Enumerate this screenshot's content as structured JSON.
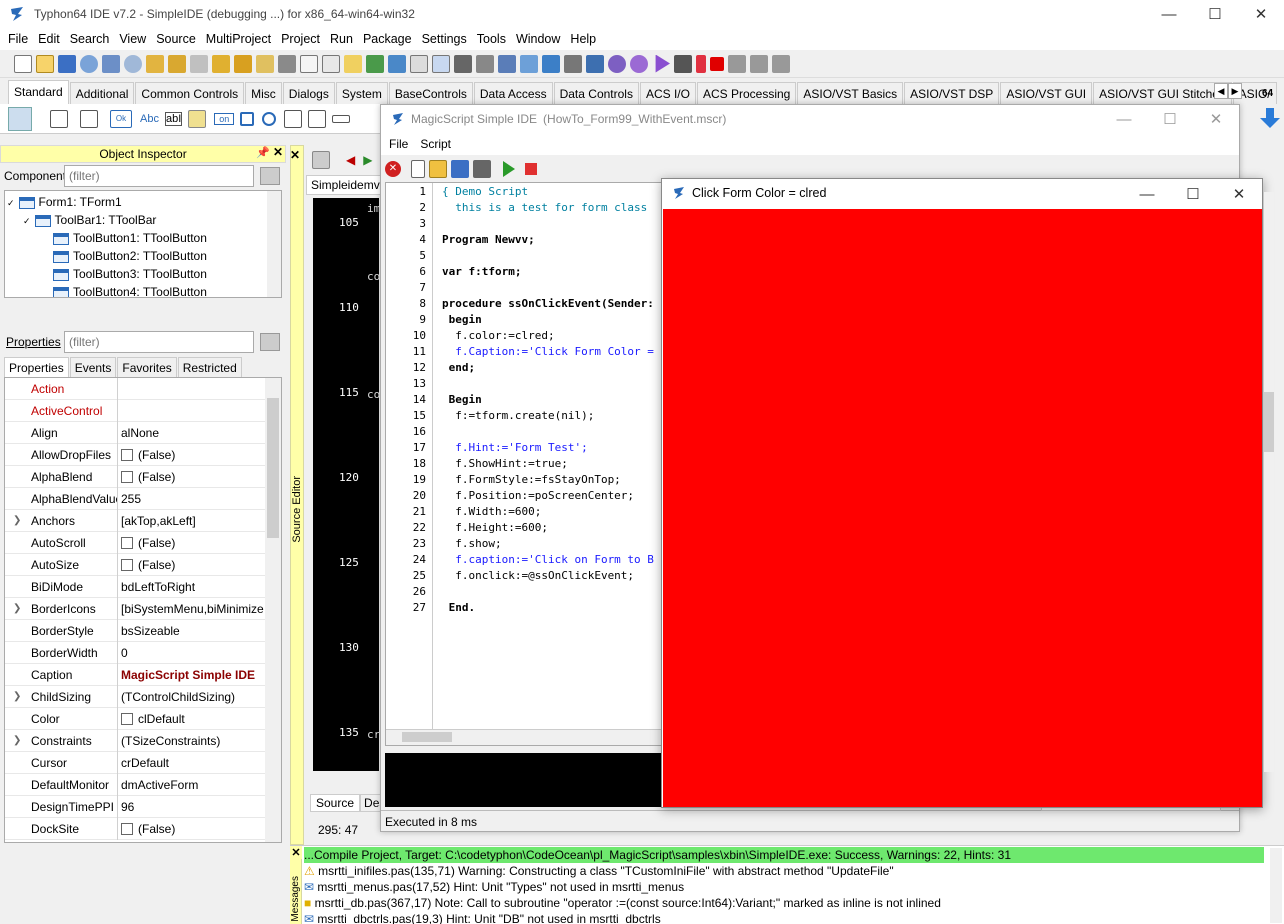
{
  "window": {
    "title": "Typhon64 IDE v7.2 - SimpleIDE (debugging ...) for x86_64-win64-win32"
  },
  "menu": [
    "File",
    "Edit",
    "Search",
    "View",
    "Source",
    "MultiProject",
    "Project",
    "Run",
    "Package",
    "Settings",
    "Tools",
    "Window",
    "Help"
  ],
  "palette_tabs": [
    "Standard",
    "Additional",
    "Common Controls",
    "Misc",
    "Dialogs",
    "System",
    "BaseControls",
    "Data Access",
    "Data Controls",
    "ACS I/O",
    "ACS Processing",
    "ASIO/VST Basics",
    "ASIO/VST DSP",
    "ASIO/VST GUI",
    "ASIO/VST GUI Stitched",
    "ASIO/"
  ],
  "palette_badge": "64",
  "object_inspector": {
    "title": "Object Inspector",
    "components_label": "Components",
    "filter_placeholder": "(filter)",
    "tree": [
      {
        "label": "Form1: TForm1"
      },
      {
        "label": "ToolBar1: TToolBar"
      },
      {
        "label": "ToolButton1: TToolButton"
      },
      {
        "label": "ToolButton2: TToolButton"
      },
      {
        "label": "ToolButton3: TToolButton"
      },
      {
        "label": "ToolButton4: TToolButton"
      }
    ],
    "properties_label": "Properties",
    "tabs": [
      "Properties",
      "Events",
      "Favorites",
      "Restricted"
    ],
    "properties": [
      {
        "name": "Action",
        "value": "",
        "expand": false,
        "check": false,
        "red": true
      },
      {
        "name": "ActiveControl",
        "value": "",
        "expand": false,
        "check": false,
        "red": true
      },
      {
        "name": "Align",
        "value": "alNone",
        "expand": false,
        "check": false
      },
      {
        "name": "AllowDropFiles",
        "value": "(False)",
        "expand": false,
        "check": true
      },
      {
        "name": "AlphaBlend",
        "value": "(False)",
        "expand": false,
        "check": true
      },
      {
        "name": "AlphaBlendValue",
        "value": "255",
        "expand": false,
        "check": false
      },
      {
        "name": "Anchors",
        "value": "[akTop,akLeft]",
        "expand": true,
        "check": false
      },
      {
        "name": "AutoScroll",
        "value": "(False)",
        "expand": false,
        "check": true
      },
      {
        "name": "AutoSize",
        "value": "(False)",
        "expand": false,
        "check": true
      },
      {
        "name": "BiDiMode",
        "value": "bdLeftToRight",
        "expand": false,
        "check": false
      },
      {
        "name": "BorderIcons",
        "value": "[biSystemMenu,biMinimize",
        "expand": true,
        "check": false
      },
      {
        "name": "BorderStyle",
        "value": "bsSizeable",
        "expand": false,
        "check": false
      },
      {
        "name": "BorderWidth",
        "value": "0",
        "expand": false,
        "check": false
      },
      {
        "name": "Caption",
        "value": "MagicScript Simple IDE",
        "expand": false,
        "check": false,
        "bold": true
      },
      {
        "name": "ChildSizing",
        "value": "(TControlChildSizing)",
        "expand": true,
        "check": false
      },
      {
        "name": "Color",
        "value": "clDefault",
        "expand": false,
        "check": true
      },
      {
        "name": "Constraints",
        "value": "(TSizeConstraints)",
        "expand": true,
        "check": false
      },
      {
        "name": "Cursor",
        "value": "crDefault",
        "expand": false,
        "check": false
      },
      {
        "name": "DefaultMonitor",
        "value": "dmActiveForm",
        "expand": false,
        "check": false
      },
      {
        "name": "DesignTimePPI",
        "value": "96",
        "expand": false,
        "check": false
      },
      {
        "name": "DockSite",
        "value": "(False)",
        "expand": false,
        "check": true
      }
    ]
  },
  "source_editor": {
    "strip_label": "Source Editor",
    "tab": "Simpleidemv",
    "line_numbers": [
      "105",
      "110",
      "115",
      "120",
      "125",
      "130",
      "135"
    ],
    "snippets": [
      "im",
      "co",
      "co",
      "cr"
    ],
    "bottom_tabs": [
      "Source",
      "Des"
    ],
    "cursor_pos": "295: 47"
  },
  "magic_window": {
    "title": "MagicScript Simple IDE",
    "file": "(HowTo_Form99_WithEvent.mscr)",
    "menu": [
      "File",
      "Script"
    ],
    "status": "Executed in 8 ms",
    "code": [
      {
        "n": "1",
        "t": "{ Demo Script",
        "c": "cm"
      },
      {
        "n": "2",
        "t": "  this is a test for form class",
        "c": "cm"
      },
      {
        "n": "3",
        "t": "",
        "c": ""
      },
      {
        "n": "4",
        "t": "Program Newvv;",
        "c": "kw"
      },
      {
        "n": "5",
        "t": "",
        "c": ""
      },
      {
        "n": "6",
        "t": "var f:tform;",
        "c": "kw"
      },
      {
        "n": "7",
        "t": "",
        "c": ""
      },
      {
        "n": "8",
        "t": "procedure ssOnClickEvent(Sender:",
        "c": "kw"
      },
      {
        "n": "9",
        "t": " begin",
        "c": "kw"
      },
      {
        "n": "10",
        "t": "  f.color:=clred;",
        "c": ""
      },
      {
        "n": "11",
        "t": "  f.Caption:='Click Form Color =",
        "c": "st"
      },
      {
        "n": "12",
        "t": " end;",
        "c": "kw"
      },
      {
        "n": "13",
        "t": "",
        "c": ""
      },
      {
        "n": "14",
        "t": " Begin",
        "c": "kw"
      },
      {
        "n": "15",
        "t": "  f:=tform.create(nil);",
        "c": ""
      },
      {
        "n": "16",
        "t": "",
        "c": ""
      },
      {
        "n": "17",
        "t": "  f.Hint:='Form Test';",
        "c": "st"
      },
      {
        "n": "18",
        "t": "  f.ShowHint:=true;",
        "c": ""
      },
      {
        "n": "19",
        "t": "  f.FormStyle:=fsStayOnTop;",
        "c": ""
      },
      {
        "n": "20",
        "t": "  f.Position:=poScreenCenter;",
        "c": ""
      },
      {
        "n": "21",
        "t": "  f.Width:=600;",
        "c": ""
      },
      {
        "n": "22",
        "t": "  f.Height:=600;",
        "c": ""
      },
      {
        "n": "23",
        "t": "  f.show;",
        "c": ""
      },
      {
        "n": "24",
        "t": "  f.caption:='Click on Form to B",
        "c": "st"
      },
      {
        "n": "25",
        "t": "  f.onclick:=@ssOnClickEvent;",
        "c": ""
      },
      {
        "n": "26",
        "t": "",
        "c": ""
      },
      {
        "n": "27",
        "t": " End.",
        "c": "kw"
      }
    ]
  },
  "red_form": {
    "title": "Click Form Color = clred",
    "color": "#ff0000"
  },
  "messages": {
    "strip_label": "Messages",
    "lines": [
      "...Compile Project, Target: C:\\codetyphon\\CodeOcean\\pl_MagicScript\\samples\\xbin\\SimpleIDE.exe: Success, Warnings: 22, Hints: 31",
      "msrtti_inifiles.pas(135,71) Warning: Constructing a class \"TCustomIniFile\" with abstract method \"UpdateFile\"",
      "msrtti_menus.pas(17,52) Hint: Unit \"Types\" not used in msrtti_menus",
      "msrtti_db.pas(367,17) Note: Call to subroutine \"operator :=(const source:Int64):Variant;\" marked as inline is not inlined",
      "msrtti_dbctrls.pas(19,3) Hint: Unit \"DB\" not used in msrtti_dbctrls"
    ],
    "success_color": "#6ee86e"
  }
}
